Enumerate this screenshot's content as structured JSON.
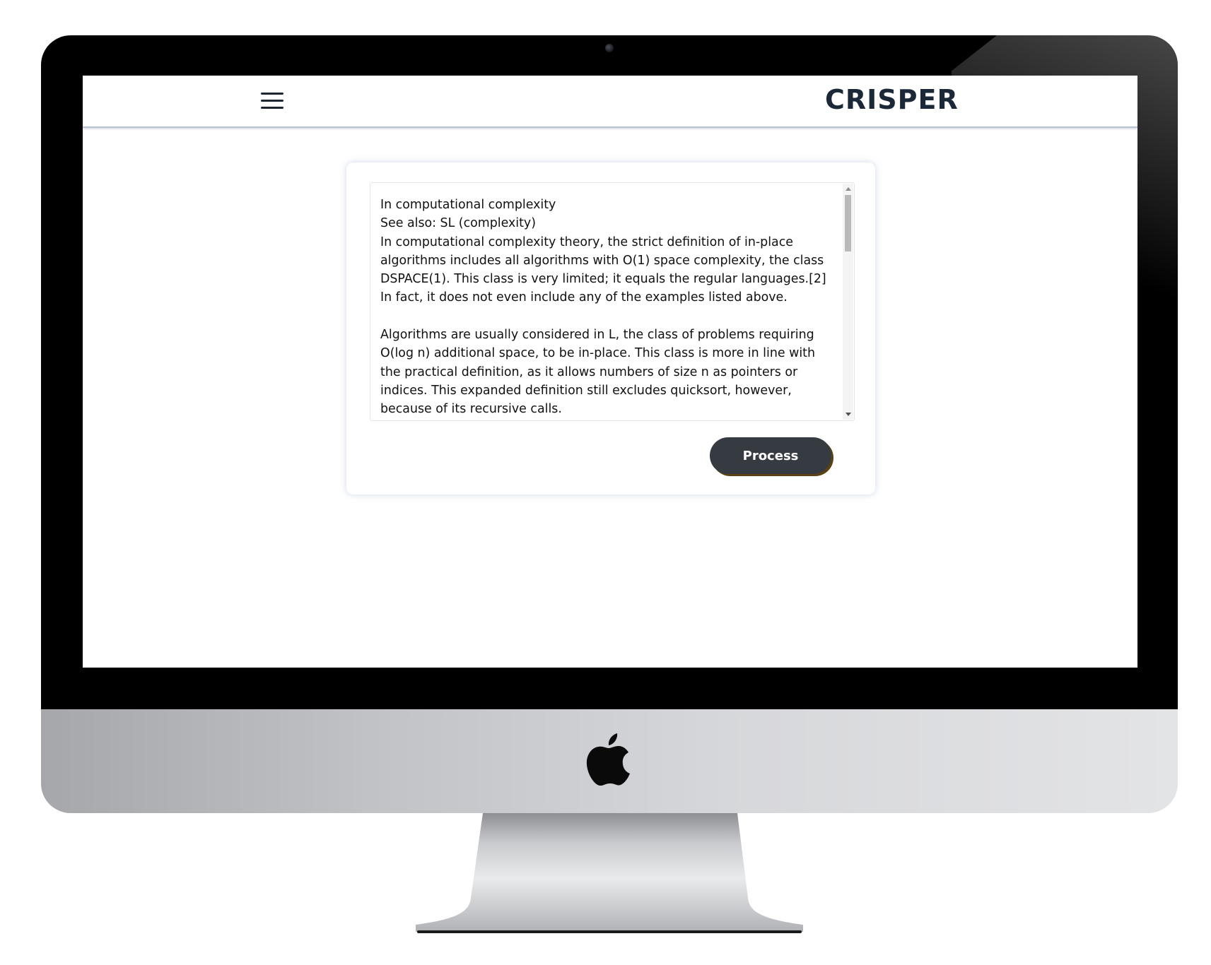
{
  "header": {
    "brand": "CRISPER",
    "menu_icon": "hamburger-menu-icon"
  },
  "editor": {
    "text": "In computational complexity\nSee also: SL (complexity)\nIn computational complexity theory, the strict definition of in-place algorithms includes all algorithms with O(1) space complexity, the class DSPACE(1). This class is very limited; it equals the regular languages.[2] In fact, it does not even include any of the examples listed above.\n\nAlgorithms are usually considered in L, the class of problems requiring O(log n) additional space, to be in-place. This class is more in line with the practical definition, as it allows numbers of size n as pointers or indices. This expanded definition still excludes quicksort, however, because of its recursive calls."
  },
  "actions": {
    "process_label": "Process"
  },
  "device": {
    "logo_icon": "apple-logo-icon"
  },
  "colors": {
    "brand_text": "#1b2838",
    "button_bg": "#363b41",
    "button_shadow": "#5a4216"
  }
}
